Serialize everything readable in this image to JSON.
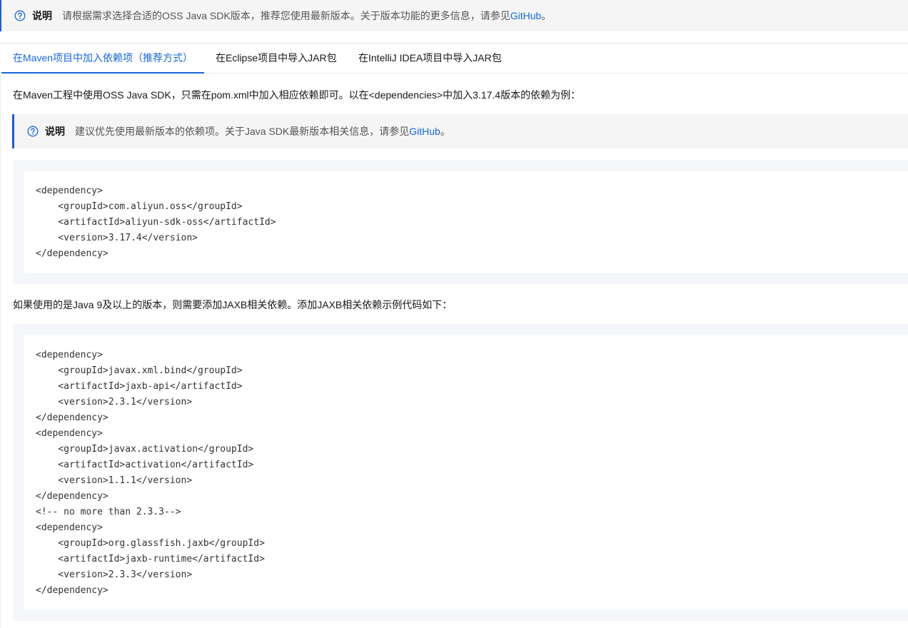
{
  "top_note": {
    "label": "说明",
    "text": "请根据需求选择合适的OSS Java SDK版本，推荐您使用最新版本。关于版本功能的更多信息，请参见",
    "link": "GitHub",
    "suffix": "。"
  },
  "tabs": [
    {
      "label": "在Maven项目中加入依赖项（推荐方式）",
      "active": true
    },
    {
      "label": "在Eclipse项目中导入JAR包",
      "active": false
    },
    {
      "label": "在IntelliJ IDEA项目中导入JAR包",
      "active": false
    }
  ],
  "paragraph_1": "在Maven工程中使用OSS Java SDK，只需在pom.xml中加入相应依赖即可。以在<dependencies>中加入3.17.4版本的依赖为例：",
  "inner_note": {
    "label": "说明",
    "text": "建议优先使用最新版本的依赖项。关于Java SDK最新版本相关信息，请参见",
    "link": "GitHub",
    "suffix": "。"
  },
  "code_1": "<dependency>\n    <groupId>com.aliyun.oss</groupId>\n    <artifactId>aliyun-sdk-oss</artifactId>\n    <version>3.17.4</version>\n</dependency>",
  "paragraph_2": "如果使用的是Java 9及以上的版本，则需要添加JAXB相关依赖。添加JAXB相关依赖示例代码如下：",
  "code_2": "<dependency>\n    <groupId>javax.xml.bind</groupId>\n    <artifactId>jaxb-api</artifactId>\n    <version>2.3.1</version>\n</dependency>\n<dependency>\n    <groupId>javax.activation</groupId>\n    <artifactId>activation</artifactId>\n    <version>1.1.1</version>\n</dependency>\n<!-- no more than 2.3.3-->\n<dependency>\n    <groupId>org.glassfish.jaxb</groupId>\n    <artifactId>jaxb-runtime</artifactId>\n    <version>2.3.3</version>\n</dependency>",
  "icons": {
    "note": "help-circle-icon"
  },
  "colors": {
    "accent": "#1667dc",
    "note_bg": "#f5f5f5",
    "code_bg": "#f4f6f9"
  }
}
